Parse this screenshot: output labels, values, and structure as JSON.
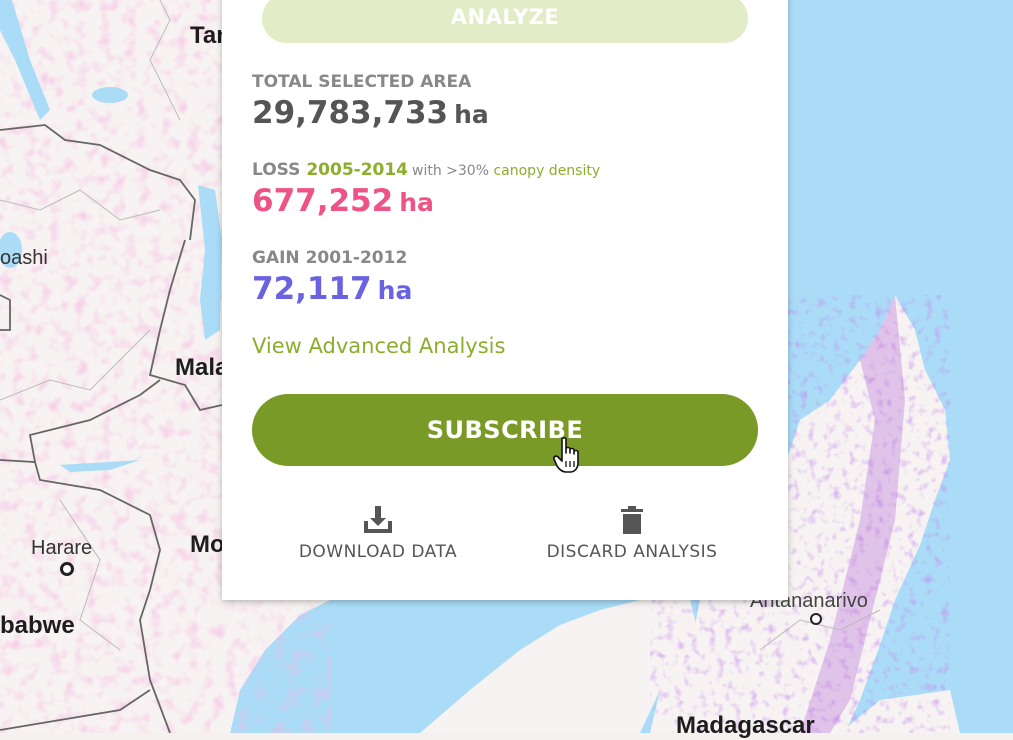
{
  "map": {
    "labels": {
      "tanzania_partial": "Tar",
      "lubumbashi_partial": "oashi",
      "malawi_partial": "Mala",
      "mozambique_partial": "Mo",
      "harare": "Harare",
      "zimbabwe_partial": "babwe",
      "antananarivo": "Antananarivo",
      "madagascar": "Madagascar"
    },
    "colors": {
      "water": "#aadcf7",
      "land": "#f5f1ef",
      "loss": "#ef5285",
      "gain": "#6a63e1"
    }
  },
  "panel": {
    "analyze_label": "ANALYZE",
    "area": {
      "label": "TOTAL SELECTED AREA",
      "value": "29,783,733",
      "unit": "ha"
    },
    "loss": {
      "label": "LOSS",
      "years": "2005-2014",
      "qualifier": "with >30%",
      "qualifier_link": "canopy density",
      "value": "677,252",
      "unit": "ha"
    },
    "gain": {
      "label": "GAIN 2001-2012",
      "value": "72,117",
      "unit": "ha"
    },
    "advanced_link": "View Advanced Analysis",
    "subscribe_label": "SUBSCRIBE",
    "actions": {
      "download": {
        "label": "DOWNLOAD DATA",
        "icon": "download-icon"
      },
      "discard": {
        "label": "DISCARD ANALYSIS",
        "icon": "trash-icon"
      }
    },
    "colors": {
      "accent": "#8dad2d",
      "button": "#7a9a28",
      "analyze_button": "#e2ecc6"
    }
  }
}
